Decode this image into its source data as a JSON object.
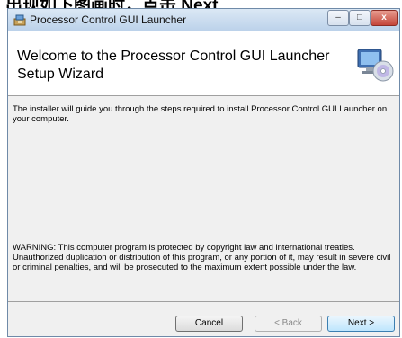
{
  "page_caption": "出现如下图画时，点击 Next.",
  "window": {
    "title": "Processor Control GUI Launcher",
    "controls": {
      "minimize": "–",
      "maximize": "□",
      "close": "x"
    }
  },
  "header": {
    "title_line1": "Welcome to the Processor Control GUI Launcher",
    "title_line2": "Setup Wizard"
  },
  "body": {
    "intro": "The installer will guide you through the steps required to install Processor Control GUI Launcher on your computer.",
    "warning": "WARNING: This computer program is protected by copyright law and international treaties. Unauthorized duplication or distribution of this program, or any portion of it, may result in severe civil or criminal penalties, and will be prosecuted to the maximum extent possible under the law."
  },
  "buttons": {
    "cancel": "Cancel",
    "back": "< Back",
    "next": "Next >"
  },
  "icons": {
    "title_icon": "installer-icon",
    "header_graphic": "computer-cd-icon"
  }
}
